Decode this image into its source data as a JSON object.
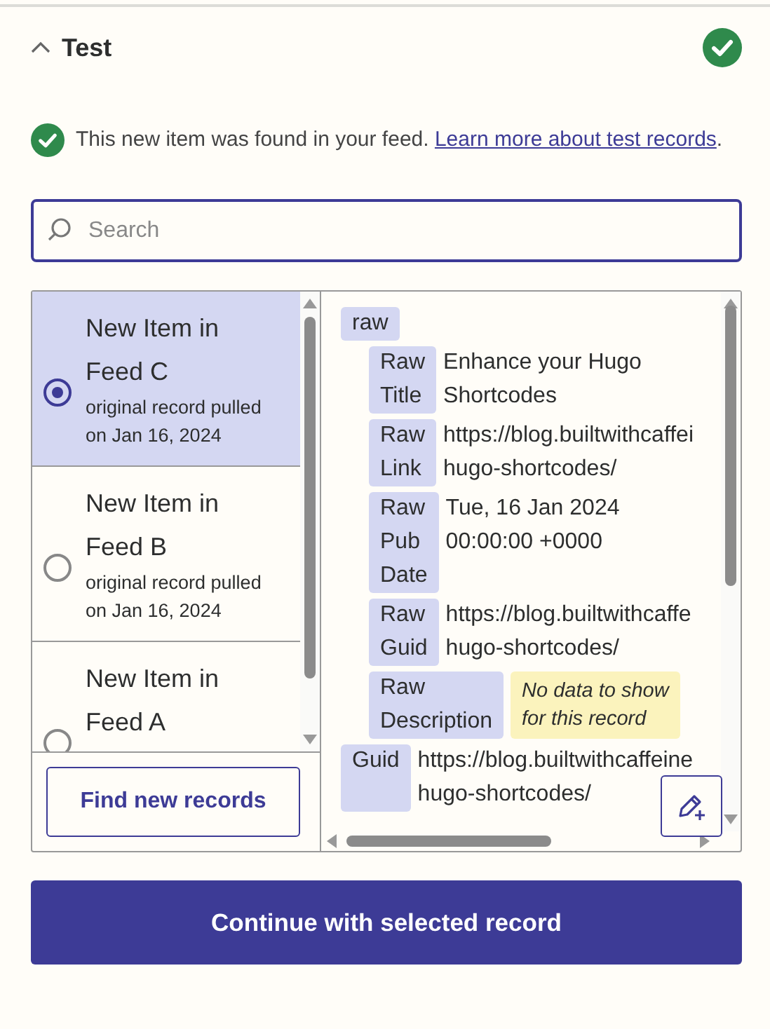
{
  "section": {
    "title": "Test",
    "expanded": true,
    "complete": true
  },
  "message": {
    "text": "This new item was found in your feed. ",
    "link": "Learn more about test records",
    "suffix": "."
  },
  "search": {
    "placeholder": "Search"
  },
  "records": [
    {
      "title": "New Item in Feed C",
      "subtitle": "original record pulled on Jan 16, 2024",
      "selected": true
    },
    {
      "title": "New Item in Feed B",
      "subtitle": "original record pulled on Jan 16, 2024",
      "selected": false
    },
    {
      "title": "New Item in Feed A",
      "selected": false
    }
  ],
  "find_button": "Find new records",
  "fields": [
    {
      "kind": "group",
      "key": "raw",
      "children": [
        {
          "kind": "text",
          "key": "Raw Title",
          "lines": [
            "Enhance your Hugo",
            "Shortcodes"
          ]
        },
        {
          "kind": "text",
          "key": "Raw Link",
          "lines": [
            "https://blog.builtwithcaffei",
            "hugo-shortcodes/"
          ]
        },
        {
          "kind": "text",
          "key": "Raw Pub Date",
          "lines": [
            "Tue, 16 Jan 2024",
            "00:00:00 +0000"
          ]
        },
        {
          "kind": "text",
          "key": "Raw Guid",
          "lines": [
            "https://blog.builtwithcaffe",
            "hugo-shortcodes/"
          ]
        },
        {
          "kind": "empty",
          "key": "Raw Description",
          "lines": [
            "No data to show",
            "for this record"
          ]
        }
      ]
    },
    {
      "kind": "text",
      "key": "Guid",
      "lines": [
        "https://blog.builtwithcaffeine",
        "hugo-shortcodes/"
      ]
    }
  ],
  "continue_button": "Continue with selected record"
}
